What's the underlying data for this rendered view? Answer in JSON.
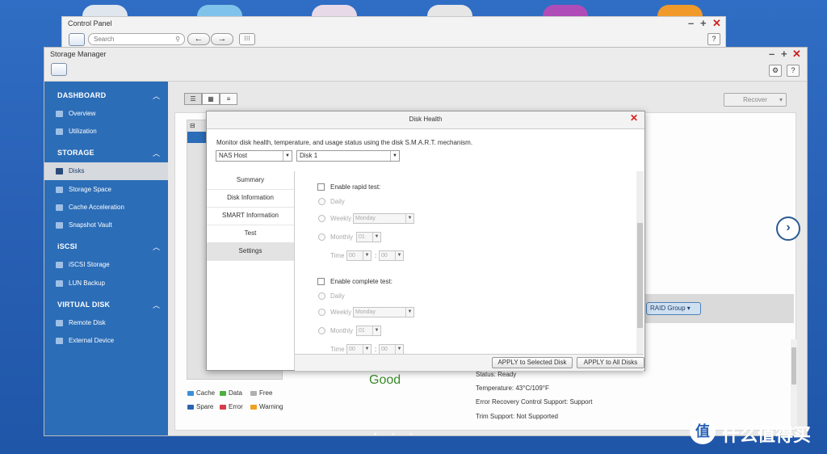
{
  "control_panel": {
    "title": "Control Panel",
    "search_placeholder": "Search",
    "help": "?"
  },
  "storage_manager": {
    "title": "Storage Manager",
    "help": "?",
    "sidebar": {
      "sections": [
        {
          "label": "DASHBOARD",
          "items": [
            "Overview",
            "Utilization"
          ]
        },
        {
          "label": "STORAGE",
          "items": [
            "Disks",
            "Storage Space",
            "Cache Acceleration",
            "Snapshot Vault"
          ]
        },
        {
          "label": "iSCSI",
          "items": [
            "iSCSI Storage",
            "LUN Backup"
          ]
        },
        {
          "label": "VIRTUAL DISK",
          "items": [
            "Remote Disk",
            "External Device"
          ]
        }
      ]
    },
    "recover_button": "Recover",
    "raid_group_button": "RAID Group",
    "health_status": "Good",
    "legend": {
      "cache": "Cache",
      "data": "Data",
      "free": "Free",
      "spare": "Spare",
      "error": "Error",
      "warning": "Warning"
    },
    "info": [
      "Status: Ready",
      "Temperature: 43°C/109°F",
      "Error Recovery Control Support: Support",
      "Trim Support: Not Supported"
    ]
  },
  "dialog": {
    "title": "Disk Health",
    "description": "Monitor disk health, temperature, and usage status using the disk S.M.A.R.T. mechanism.",
    "host_select": "NAS Host",
    "disk_select": "Disk 1",
    "tabs": [
      "Summary",
      "Disk Information",
      "SMART Information",
      "Test",
      "Settings"
    ],
    "active_tab": "Settings",
    "rapid": {
      "label": "Enable rapid test:",
      "daily": "Daily",
      "weekly": "Weekly",
      "weekly_value": "Monday",
      "monthly": "Monthly",
      "monthly_value": "01",
      "time": "Time",
      "hour": "00",
      "minute": "00"
    },
    "complete": {
      "label": "Enable complete test:",
      "daily": "Daily",
      "weekly": "Weekly",
      "weekly_value": "Monday",
      "monthly": "Monthly",
      "monthly_value": "01",
      "time": "Time",
      "hour": "00",
      "minute": "00"
    },
    "apply_selected": "APPLY to Selected Disk",
    "apply_all": "APPLY to All Disks"
  },
  "brand": {
    "logo_char": "值",
    "text": "什么值得买"
  },
  "colors": {
    "accent": "#2b6db7",
    "close": "#d22222",
    "good": "#3a8a2a"
  }
}
